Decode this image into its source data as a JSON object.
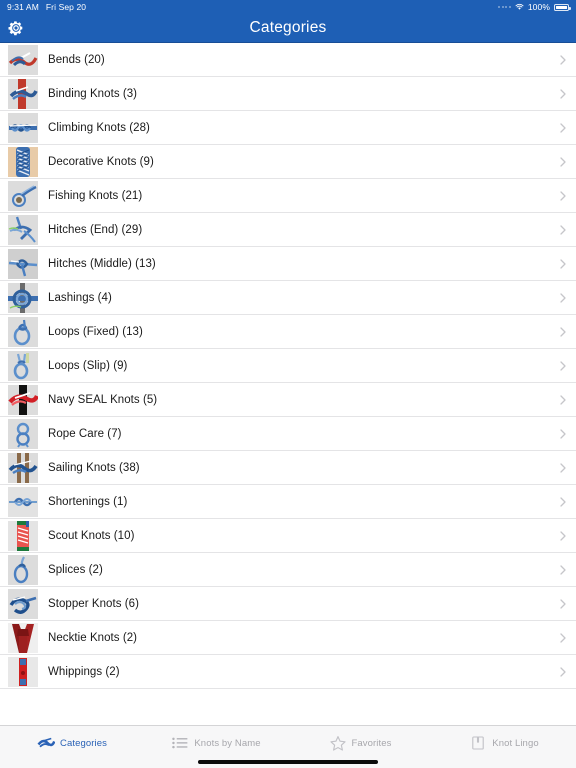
{
  "statusbar": {
    "time": "9:31 AM",
    "date": "Fri Sep 20",
    "battery_percent": "100%",
    "wifi_icon": "wifi-icon",
    "battery_icon": "battery-icon"
  },
  "navbar": {
    "title": "Categories",
    "settings_icon": "gear-icon"
  },
  "colors": {
    "navbar_blue": "#1e5fb5",
    "tab_active": "#2a62b6",
    "tab_inactive": "#a7a7ac",
    "separator": "#e4e4e6",
    "thumb_bg": "#dddddd"
  },
  "list": {
    "rows": [
      {
        "label": "Bends (20)",
        "thumb": "bends-thumbnail",
        "chevron": "chevron-right-icon"
      },
      {
        "label": "Binding Knots (3)",
        "thumb": "binding-knots-thumbnail",
        "chevron": "chevron-right-icon"
      },
      {
        "label": "Climbing Knots (28)",
        "thumb": "climbing-knots-thumbnail",
        "chevron": "chevron-right-icon"
      },
      {
        "label": "Decorative Knots (9)",
        "thumb": "decorative-knots-thumbnail",
        "chevron": "chevron-right-icon"
      },
      {
        "label": "Fishing Knots (21)",
        "thumb": "fishing-knots-thumbnail",
        "chevron": "chevron-right-icon"
      },
      {
        "label": "Hitches (End) (29)",
        "thumb": "hitches-end-thumbnail",
        "chevron": "chevron-right-icon"
      },
      {
        "label": "Hitches (Middle) (13)",
        "thumb": "hitches-middle-thumbnail",
        "chevron": "chevron-right-icon"
      },
      {
        "label": "Lashings (4)",
        "thumb": "lashings-thumbnail",
        "chevron": "chevron-right-icon"
      },
      {
        "label": "Loops (Fixed) (13)",
        "thumb": "loops-fixed-thumbnail",
        "chevron": "chevron-right-icon"
      },
      {
        "label": "Loops (Slip) (9)",
        "thumb": "loops-slip-thumbnail",
        "chevron": "chevron-right-icon"
      },
      {
        "label": "Navy SEAL Knots (5)",
        "thumb": "navy-seal-knots-thumbnail",
        "chevron": "chevron-right-icon"
      },
      {
        "label": "Rope Care (7)",
        "thumb": "rope-care-thumbnail",
        "chevron": "chevron-right-icon"
      },
      {
        "label": "Sailing Knots (38)",
        "thumb": "sailing-knots-thumbnail",
        "chevron": "chevron-right-icon"
      },
      {
        "label": "Shortenings (1)",
        "thumb": "shortenings-thumbnail",
        "chevron": "chevron-right-icon"
      },
      {
        "label": "Scout Knots (10)",
        "thumb": "scout-knots-thumbnail",
        "chevron": "chevron-right-icon"
      },
      {
        "label": "Splices (2)",
        "thumb": "splices-thumbnail",
        "chevron": "chevron-right-icon"
      },
      {
        "label": "Stopper Knots (6)",
        "thumb": "stopper-knots-thumbnail",
        "chevron": "chevron-right-icon"
      },
      {
        "label": "Necktie Knots (2)",
        "thumb": "necktie-knots-thumbnail",
        "chevron": "chevron-right-icon"
      },
      {
        "label": "Whippings (2)",
        "thumb": "whippings-thumbnail",
        "chevron": "chevron-right-icon"
      }
    ]
  },
  "tabbar": {
    "tabs": [
      {
        "label": "Categories",
        "icon": "knot-icon",
        "active": true
      },
      {
        "label": "Knots by Name",
        "icon": "list-icon",
        "active": false
      },
      {
        "label": "Favorites",
        "icon": "star-icon",
        "active": false
      },
      {
        "label": "Knot Lingo",
        "icon": "book-icon",
        "active": false
      }
    ]
  }
}
